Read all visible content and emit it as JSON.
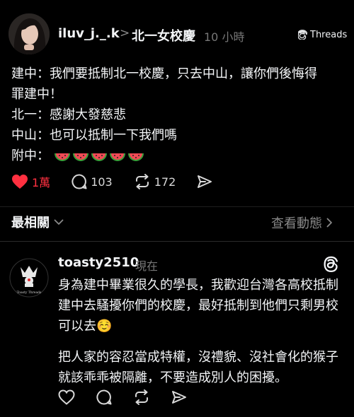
{
  "post": {
    "username": "iluv_j._.k",
    "separator": ">",
    "topic": "北一女校慶",
    "time": "10 小時",
    "threads_label": "Threads",
    "lines": [
      "建中：我們要抵制北一校慶，只去中山，讓你們後悔得",
      "罪建中！",
      "北一：感謝大發慈悲",
      "中山：也可以抵制一下我們嗎"
    ],
    "last_line_prefix": "附中：",
    "emoji_count": 5,
    "emoji_icon": "watermelon-icon",
    "likes": "1萬",
    "comments": "103",
    "reposts": "172"
  },
  "section": {
    "sort_label": "最相關",
    "activity_label": "查看動態"
  },
  "reply": {
    "username": "toasty2510",
    "time": "現在",
    "avatar_text": "Toasty Threads",
    "paragraph1": "身為建中畢業很久的學長，我歡迎台灣各高校抵制建中去騷擾你們的校慶，最好抵制到他們只剩男校可以去☺️",
    "paragraph2": "把人家的容忍當成特權，沒禮貌、沒社會化的猴子就該乖乖被隔離，不要造成別人的困擾。"
  },
  "colors": {
    "background": "#000000",
    "text": "#f3f5f7",
    "muted": "#777777",
    "like": "#ff3040"
  }
}
